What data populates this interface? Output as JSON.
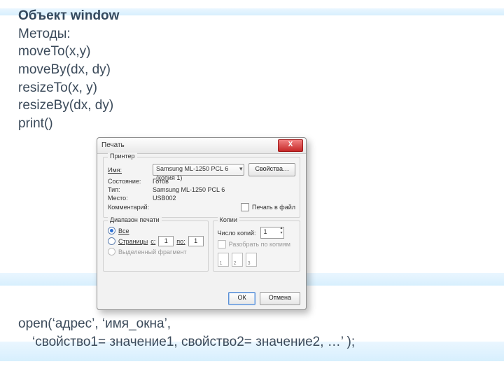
{
  "slide": {
    "title": "Объект window",
    "subtitle": "Методы:",
    "methods": [
      "moveTo(x,y)",
      "moveBy(dx, dy)",
      "resizeTo(x, y)",
      "resizeBy(dx, dy)",
      "print()"
    ],
    "open_line1": "open(‘адрес’, ‘имя_окна’,",
    "open_line2": "‘свойство1= значение1, свойство2=  значение2, …’ );"
  },
  "dialog": {
    "title": "Печать",
    "close": "X",
    "printer": {
      "group": "Принтер",
      "name_label": "Имя:",
      "name_value": "Samsung ML-1250 PCL 6 (копия 1)",
      "props_btn": "Свойства…",
      "state_label": "Состояние:",
      "state_value": "Готов",
      "type_label": "Тип:",
      "type_value": "Samsung ML-1250 PCL 6",
      "where_label": "Место:",
      "where_value": "USB002",
      "comment_label": "Комментарий:",
      "to_file": "Печать в файл"
    },
    "range": {
      "group": "Диапазон печати",
      "all": "Все",
      "pages": "Страницы",
      "from_label": "с:",
      "from_value": "1",
      "to_label": "по:",
      "to_value": "1",
      "selection": "Выделенный фрагмент"
    },
    "copies": {
      "group": "Копии",
      "count_label": "Число копий:",
      "count_value": "1",
      "collate": "Разобрать по копиям",
      "p1": "1",
      "p2": "2",
      "p3": "3"
    },
    "ok": "ОК",
    "cancel": "Отмена"
  }
}
